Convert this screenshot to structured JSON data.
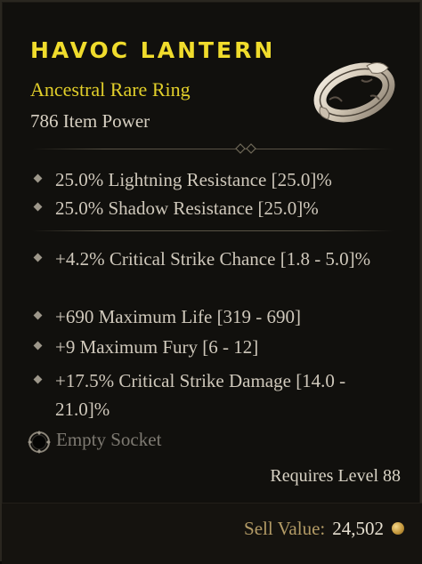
{
  "item": {
    "name": "HAVOC LANTERN",
    "type": "Ancestral Rare Ring",
    "power": "786 Item Power",
    "image_icon": "ring-icon"
  },
  "implicit_stats": [
    "25.0% Lightning Resistance [25.0]%",
    "25.0% Shadow Resistance [25.0]%"
  ],
  "affix_stats": [
    "+4.2% Critical Strike Chance [1.8 - 5.0]%",
    "+690 Maximum Life [319 - 690]",
    "+9 Maximum Fury [6 - 12]",
    "+17.5% Critical Strike Damage [14.0 - 21.0]%"
  ],
  "socket": {
    "label": "Empty Socket",
    "icon": "empty-socket-icon"
  },
  "requirement": "Requires Level 88",
  "sell": {
    "label": "Sell Value:",
    "value": "24,502",
    "icon": "gold-coin-icon"
  },
  "colors": {
    "title": "#f0dc2c",
    "rarity": "#e2cf2a",
    "text": "#cfc8bb",
    "muted": "#7e7a72",
    "sell_label": "#b39b66"
  }
}
